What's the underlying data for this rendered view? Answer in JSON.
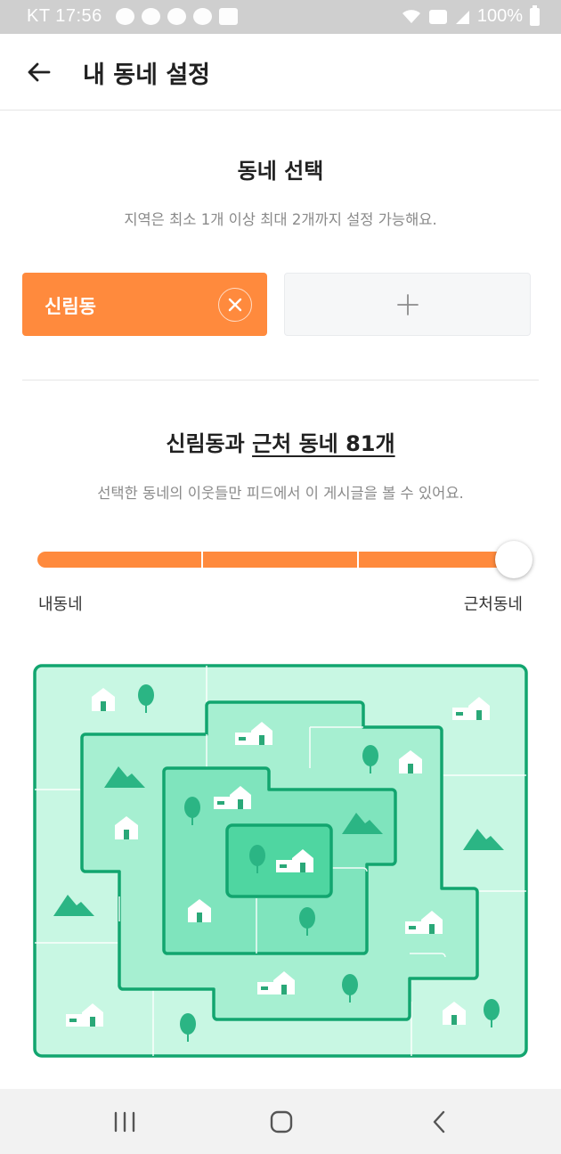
{
  "status_bar": {
    "carrier_time": "KT 17:56",
    "battery": "100%"
  },
  "app_bar": {
    "title": "내 동네 설정",
    "back_icon": "arrow-left-icon"
  },
  "neighborhood_select": {
    "title": "동네 선택",
    "subtitle": "지역은 최소 1개 이상 최대 2개까지 설정 가능해요.",
    "selected": {
      "label": "신림동",
      "remove_icon": "close-icon"
    },
    "add_icon": "plus-icon"
  },
  "range": {
    "title_prefix": "신림동과 ",
    "title_link": "근처 동네 81개",
    "subtitle": "선택한 동네의 이웃들만 피드에서 이 게시글을 볼 수 있어요.",
    "slider": {
      "steps": 4,
      "selected_step": 4,
      "min_label": "내동네",
      "max_label": "근처동네"
    }
  },
  "map": {
    "illustration": "neighborhood-range-map",
    "colors": {
      "outer": "#c8f7e3",
      "ring2": "#a6efd1",
      "ring3": "#7fe4bd",
      "core": "#4fd6a1",
      "border": "#12a56f"
    }
  },
  "colors": {
    "accent": "#ff8a3d"
  },
  "nav_bar": {
    "icons": [
      "recent-apps-icon",
      "home-icon",
      "back-icon"
    ]
  }
}
